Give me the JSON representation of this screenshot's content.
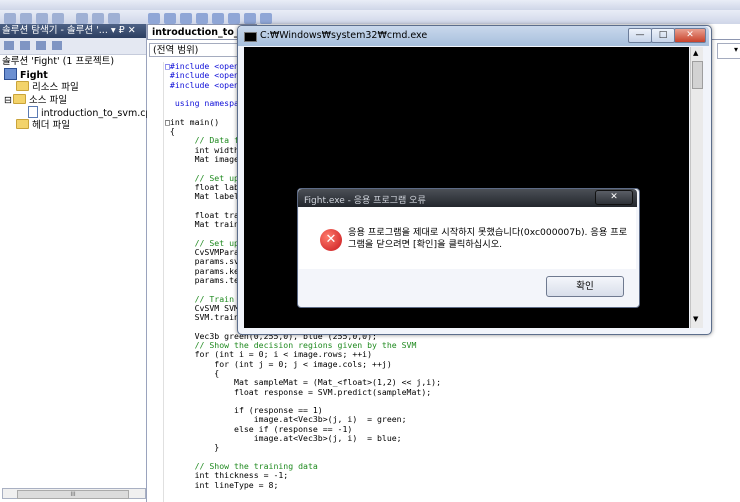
{
  "solution_explorer": {
    "header": "솔루션 탐색기 - 솔루션 '...  ▾ ₽ ✕",
    "tree": [
      {
        "label": "솔루션 'Fight' (1 프로젝트)"
      },
      {
        "label": "Fight"
      },
      {
        "label": "리소스 파일"
      },
      {
        "label": "소스 파일"
      },
      {
        "label": "introduction_to_svm.cpp"
      },
      {
        "label": "헤더 파일"
      }
    ],
    "scroll_grip": "III"
  },
  "editor": {
    "tab_label": "introduction_to_svm.c",
    "scope_label": "(전역 범위)",
    "code_lines": [
      {
        "text": "□#include <opencv",
        "cls": "kw"
      },
      {
        "text": " #include <opencv",
        "cls": "kw"
      },
      {
        "text": " #include <opencv",
        "cls": "kw"
      },
      {
        "text": "",
        "cls": ""
      },
      {
        "text": "  using namespace",
        "cls": "kw"
      },
      {
        "text": "",
        "cls": ""
      },
      {
        "text": "□int main()",
        "cls": ""
      },
      {
        "text": " {",
        "cls": ""
      },
      {
        "text": "      // Data for",
        "cls": "cm"
      },
      {
        "text": "      int width =",
        "cls": ""
      },
      {
        "text": "      Mat image =",
        "cls": ""
      },
      {
        "text": "",
        "cls": ""
      },
      {
        "text": "      // Set up tr",
        "cls": "cm"
      },
      {
        "text": "      float labels",
        "cls": ""
      },
      {
        "text": "      Mat labelsMa",
        "cls": ""
      },
      {
        "text": "",
        "cls": ""
      },
      {
        "text": "      float traini",
        "cls": ""
      },
      {
        "text": "      Mat training",
        "cls": ""
      },
      {
        "text": "",
        "cls": ""
      },
      {
        "text": "      // Set up SV",
        "cls": "cm"
      },
      {
        "text": "      CvSVMParams",
        "cls": ""
      },
      {
        "text": "      params.svm_t",
        "cls": ""
      },
      {
        "text": "      params.kerne",
        "cls": ""
      },
      {
        "text": "      params.term_",
        "cls": ""
      },
      {
        "text": "",
        "cls": ""
      },
      {
        "text": "      // Train the",
        "cls": "cm"
      },
      {
        "text": "      CvSVM SVM;",
        "cls": ""
      },
      {
        "text": "      SVM.train(trainingDataMat, labelsMat, Mat(), Mat(), params);",
        "cls": ""
      },
      {
        "text": "",
        "cls": ""
      },
      {
        "text": "      Vec3b green(0,255,0), blue (255,0,0);",
        "cls": ""
      },
      {
        "text": "      // Show the decision regions given by the SVM",
        "cls": "cm"
      },
      {
        "text": "      for (int i = 0; i < image.rows; ++i)",
        "cls": ""
      },
      {
        "text": "          for (int j = 0; j < image.cols; ++j)",
        "cls": ""
      },
      {
        "text": "          {",
        "cls": ""
      },
      {
        "text": "              Mat sampleMat = (Mat_<float>(1,2) << j,i);",
        "cls": ""
      },
      {
        "text": "              float response = SVM.predict(sampleMat);",
        "cls": ""
      },
      {
        "text": "",
        "cls": ""
      },
      {
        "text": "              if (response == 1)",
        "cls": ""
      },
      {
        "text": "                  image.at<Vec3b>(j, i)  = green;",
        "cls": ""
      },
      {
        "text": "              else if (response == -1)",
        "cls": ""
      },
      {
        "text": "                  image.at<Vec3b>(j, i)  = blue;",
        "cls": ""
      },
      {
        "text": "          }",
        "cls": ""
      },
      {
        "text": "",
        "cls": ""
      },
      {
        "text": "      // Show the training data",
        "cls": "cm"
      },
      {
        "text": "      int thickness = -1;",
        "cls": ""
      },
      {
        "text": "      int lineType = 8;",
        "cls": ""
      }
    ]
  },
  "cmd_window": {
    "title": "C:₩Windows₩system32₩cmd.exe",
    "btn_min": "—",
    "btn_max": "□",
    "btn_close": "✕"
  },
  "error_dialog": {
    "title": "Fight.exe - 응용 프로그램 오류",
    "close_label": "✕",
    "icon_glyph": "✕",
    "message": "응용 프로그램을 제대로 시작하지 못했습니다(0xc000007b). 응용 프로그램을 닫으려면 [확인]을 클릭하십시오.",
    "ok_label": "확인"
  },
  "colors": {
    "keyword": "#1010d8",
    "comment": "#1f8a1f",
    "error_icon": "#c8161c"
  }
}
